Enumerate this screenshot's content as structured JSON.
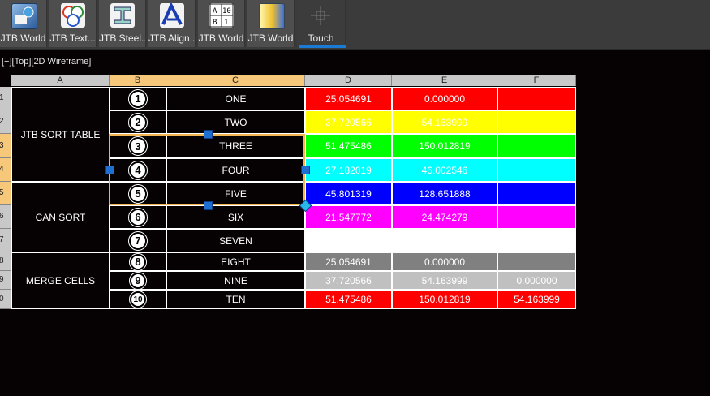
{
  "ribbon": {
    "buttons": [
      {
        "label": "JTB World",
        "icon": "jtb-world-icon"
      },
      {
        "label": "JTB Text...",
        "icon": "jtb-text-icon"
      },
      {
        "label": "JTB Steel...",
        "icon": "jtb-steel-icon"
      },
      {
        "label": "JTB Align...",
        "icon": "jtb-align-icon"
      },
      {
        "label": "JTB World",
        "icon": "jtb-table-icon"
      },
      {
        "label": "JTB World",
        "icon": "jtb-world-color-icon"
      },
      {
        "label": "Touch",
        "icon": "touch-crosshair-icon"
      }
    ]
  },
  "viewport": {
    "label": "[−][Top][2D Wireframe]"
  },
  "table": {
    "columns": [
      "A",
      "B",
      "C",
      "D",
      "E",
      "F"
    ],
    "row_numbers": [
      "1",
      "2",
      "3",
      "4",
      "5",
      "6",
      "7",
      "8",
      "9",
      "0"
    ],
    "merged": [
      "JTB SORT TABLE",
      "CAN SORT",
      "MERGE CELLS"
    ],
    "rows": [
      {
        "num": "1",
        "name": "ONE",
        "d": "25.054691",
        "e": "0.000000",
        "f": ""
      },
      {
        "num": "2",
        "name": "TWO",
        "d": "37.720566",
        "e": "54.163999",
        "f": ""
      },
      {
        "num": "3",
        "name": "THREE",
        "d": "51.475486",
        "e": "150.012819",
        "f": ""
      },
      {
        "num": "4",
        "name": "FOUR",
        "d": "27.182019",
        "e": "46.002546",
        "f": ""
      },
      {
        "num": "5",
        "name": "FIVE",
        "d": "45.801319",
        "e": "128.651888",
        "f": ""
      },
      {
        "num": "6",
        "name": "SIX",
        "d": "21.547772",
        "e": "24.474279",
        "f": ""
      },
      {
        "num": "7",
        "name": "SEVEN",
        "d": "",
        "e": "",
        "f": ""
      },
      {
        "num": "8",
        "name": "EIGHT",
        "d": "25.054691",
        "e": "0.000000",
        "f": ""
      },
      {
        "num": "9",
        "name": "NINE",
        "d": "37.720566",
        "e": "54.163999",
        "f": "0.000000"
      },
      {
        "num": "10",
        "name": "TEN",
        "d": "51.475486",
        "e": "150.012819",
        "f": "54.163999"
      }
    ],
    "row_colors": [
      "#ff0000",
      "#ffff00",
      "#00ff00",
      "#00ffff",
      "#0000ff",
      "#ff00ff",
      "#ffffff",
      "#808080",
      "#c0c0c0",
      "#ff0000"
    ],
    "selection_color": "#f3b54f"
  }
}
